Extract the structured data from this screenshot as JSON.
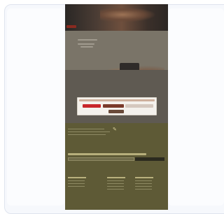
{
  "page": {
    "hero": {
      "badge_label": ""
    },
    "promo": {
      "cta_label": ""
    },
    "consent_modal": {
      "message": "",
      "buttons": {
        "accept": "",
        "settings": "",
        "reject": "",
        "more": ""
      }
    },
    "newsletter": {
      "title": "",
      "email_placeholder": "",
      "submit_label": ""
    },
    "footer": {
      "columns": [
        {
          "heading": ""
        },
        {
          "heading": ""
        },
        {
          "heading": ""
        }
      ]
    },
    "colors": {
      "background": "#ffffff",
      "card_border": "#dfe4ee",
      "page_dark": "#6b6559",
      "olive": "#5e5a36",
      "accent_red": "#c8262a",
      "accent_brown": "#7a3a2a"
    }
  }
}
